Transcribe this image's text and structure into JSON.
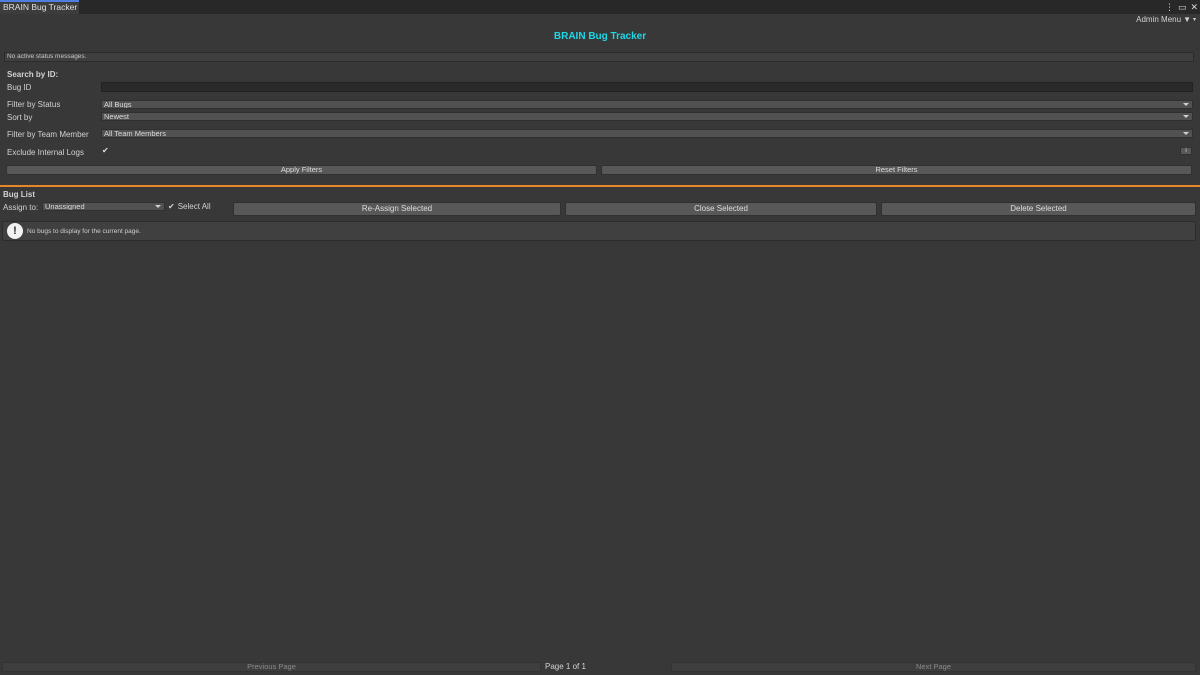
{
  "window": {
    "tab_title": "BRAIN Bug Tracker",
    "icons": [
      "more-vert-icon",
      "maximize-icon",
      "close-icon"
    ]
  },
  "header": {
    "admin_menu_label": "Admin Menu",
    "title": "BRAIN Bug Tracker",
    "title_color": "#1ed7e6"
  },
  "status": {
    "message": "No active status messages."
  },
  "filters": {
    "search_heading": "Search by ID:",
    "bug_id_label": "Bug ID",
    "bug_id_value": "",
    "status_label": "Filter by Status",
    "status_selected": "All Bugs",
    "sort_label": "Sort by",
    "sort_selected": "Newest",
    "member_label": "Filter by Team Member",
    "member_selected": "All Team Members",
    "exclude_label": "Exclude Internal Logs",
    "exclude_checked": true,
    "info_button": "i",
    "apply_label": "Apply Filters",
    "reset_label": "Reset Filters"
  },
  "bug_list": {
    "heading": "Bug List",
    "separator_color": "#e8862c",
    "assign_label": "Assign to:",
    "assign_selected": "Unassigned",
    "select_all_label": "Select All",
    "select_all_checked": true,
    "reassign_label": "Re-Assign Selected",
    "close_label": "Close Selected",
    "delete_label": "Delete Selected",
    "empty_message": "No bugs to display for the current page."
  },
  "pagination": {
    "previous_label": "Previous Page",
    "page_info": "Page 1 of 1",
    "next_label": "Next Page"
  }
}
